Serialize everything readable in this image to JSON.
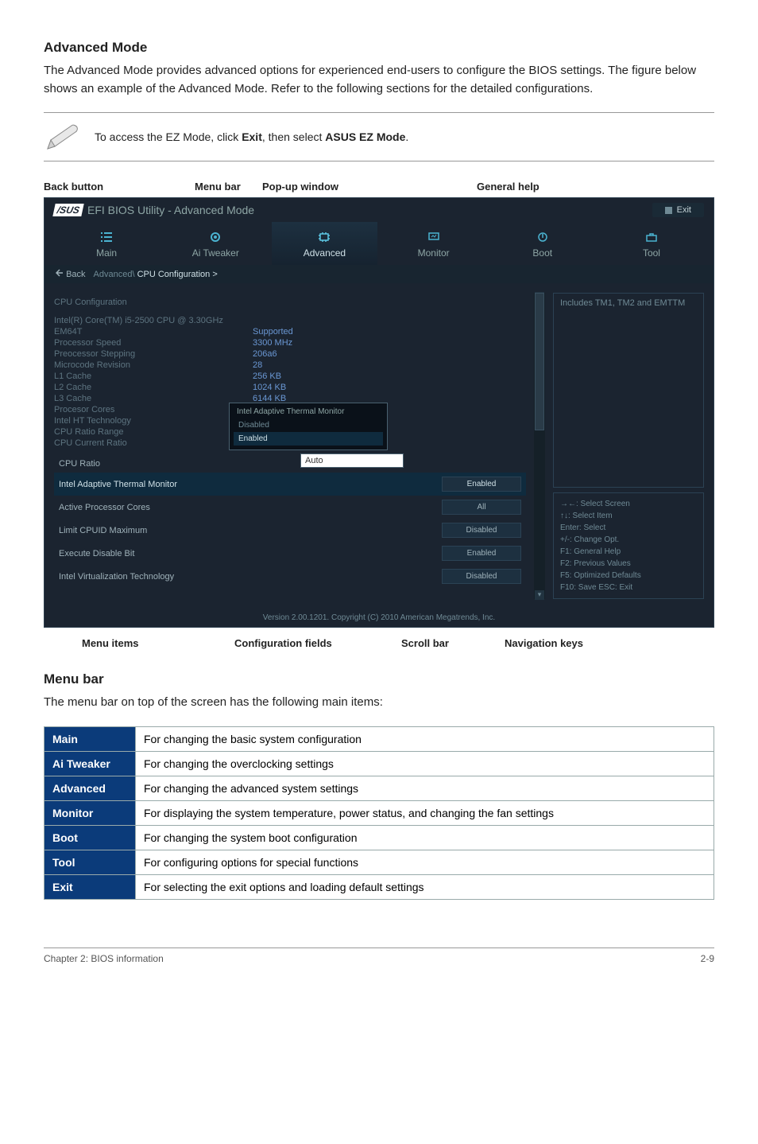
{
  "advanced_heading": "Advanced Mode",
  "advanced_body": "The Advanced Mode provides advanced options for experienced end-users to configure the BIOS settings. The figure below shows an example of the Advanced Mode. Refer to the following sections for the detailed configurations.",
  "note_prefix": "To access the EZ Mode, click ",
  "note_bold1": "Exit",
  "note_mid": ", then select ",
  "note_bold2": "ASUS EZ Mode",
  "note_suffix": ".",
  "labels": {
    "back": "Back button",
    "menu": "Menu bar",
    "popup": "Pop-up window",
    "general": "General help"
  },
  "bios": {
    "brand_logo": "ASUS",
    "brand_text": "EFI BIOS Utility - Advanced Mode",
    "exit": "Exit",
    "tabs": [
      "Main",
      "Ai Tweaker",
      "Advanced",
      "Monitor",
      "Boot",
      "Tool"
    ],
    "breadcrumb_back": "Back",
    "breadcrumb_path": "Advanced\\ ",
    "breadcrumb_active": "CPU Configuration >",
    "section": "CPU Configuration",
    "info": [
      {
        "label": "Intel(R) Core(TM) i5-2500 CPU @ 3.30GHz",
        "val": ""
      },
      {
        "label": "EM64T",
        "val": "Supported"
      },
      {
        "label": "Processor Speed",
        "val": "3300 MHz"
      },
      {
        "label": "Preocessor Stepping",
        "val": "206a6"
      },
      {
        "label": "Microcode Revision",
        "val": "28"
      },
      {
        "label": "L1 Cache",
        "val": "256 KB"
      },
      {
        "label": "L2 Cache",
        "val": "1024 KB"
      },
      {
        "label": "L3 Cache",
        "val": "6144 KB"
      },
      {
        "label": "Procesor Cores",
        "val": ""
      },
      {
        "label": "Intel HT Technology",
        "val": ""
      },
      {
        "label": "CPU Ratio Range",
        "val": ""
      },
      {
        "label": "CPU Current Ratio",
        "val": ""
      }
    ],
    "items": [
      {
        "label": "CPU Ratio",
        "val": ""
      },
      {
        "label": "Intel Adaptive Thermal Monitor",
        "val": "Enabled"
      },
      {
        "label": "Active Processor Cores",
        "val": "All"
      },
      {
        "label": "Limit CPUID Maximum",
        "val": "Disabled"
      },
      {
        "label": "Execute Disable Bit",
        "val": "Enabled"
      },
      {
        "label": "Intel Virtualization Technology",
        "val": "Disabled"
      }
    ],
    "popup_header": "Intel Adaptive Thermal Monitor",
    "popup_opts": [
      "Disabled",
      "Enabled"
    ],
    "popup_input": "Auto",
    "help_top": "Includes TM1, TM2 and EMTTM",
    "help_keys": [
      "→←: Select Screen",
      "↑↓: Select Item",
      "Enter: Select",
      "+/-: Change Opt.",
      "F1: General Help",
      "F2: Previous Values",
      "F5: Optimized Defaults",
      "F10: Save   ESC: Exit"
    ],
    "footer": "Version 2.00.1201. Copyright (C) 2010 American Megatrends, Inc."
  },
  "pointers": {
    "menu": "Menu items",
    "conf": "Configuration fields",
    "scroll": "Scroll bar",
    "nav": "Navigation keys"
  },
  "menubar_heading": "Menu bar",
  "menubar_body": "The menu bar on top of the screen has the following main items:",
  "menu_table": [
    {
      "key": "Main",
      "desc": "For changing the basic system configuration"
    },
    {
      "key": "Ai Tweaker",
      "desc": "For changing the overclocking settings"
    },
    {
      "key": "Advanced",
      "desc": "For changing the advanced system settings"
    },
    {
      "key": "Monitor",
      "desc": "For displaying the system temperature, power status, and changing the fan settings"
    },
    {
      "key": "Boot",
      "desc": "For changing the system boot configuration"
    },
    {
      "key": "Tool",
      "desc": "For configuring options for special functions"
    },
    {
      "key": "Exit",
      "desc": "For selecting the exit options and loading default settings"
    }
  ],
  "footer_left": "Chapter 2: BIOS information",
  "footer_right": "2-9"
}
